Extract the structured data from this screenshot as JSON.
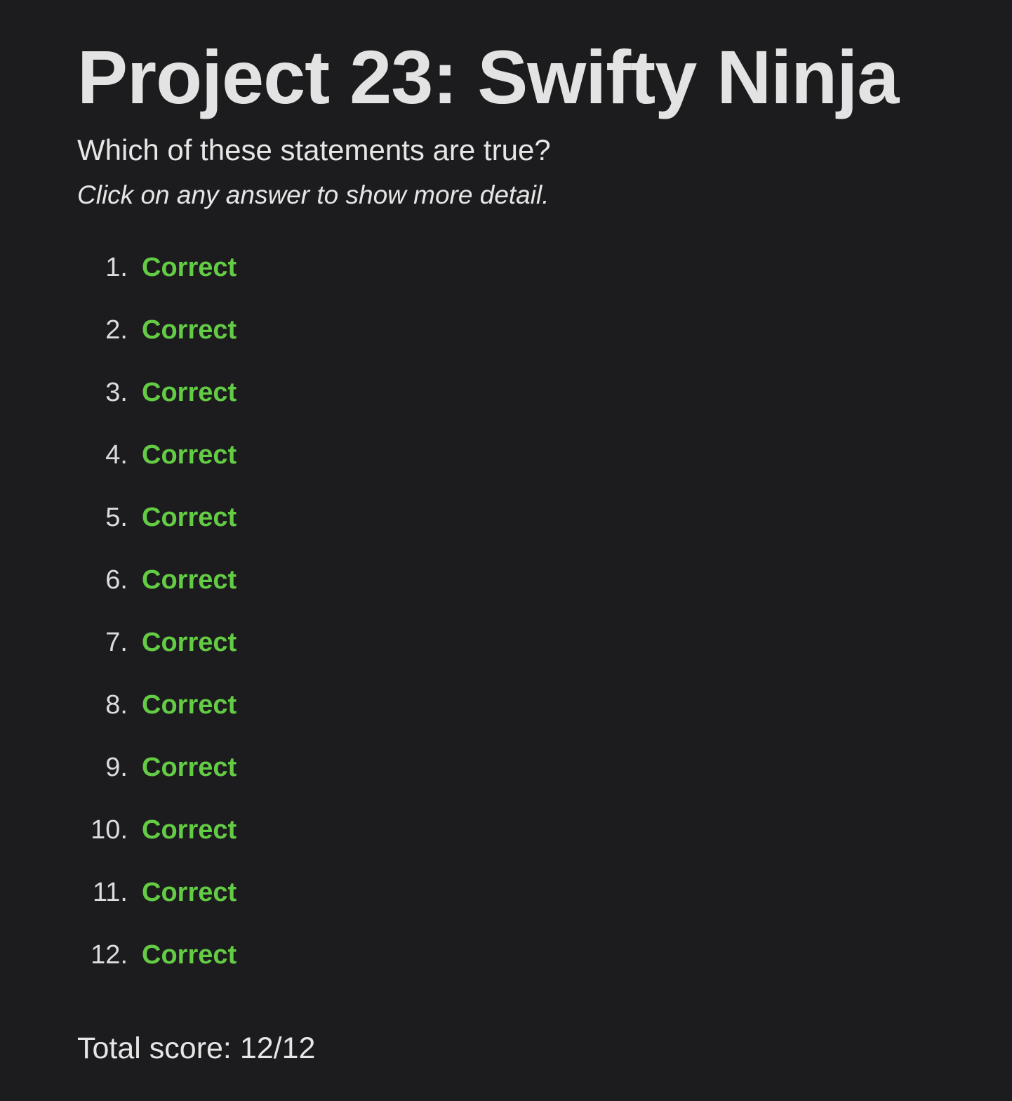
{
  "header": {
    "title": "Project 23: Swifty Ninja",
    "subtitle": "Which of these statements are true?",
    "hint": "Click on any answer to show more detail."
  },
  "answers": [
    {
      "number": "1.",
      "status": "Correct"
    },
    {
      "number": "2.",
      "status": "Correct"
    },
    {
      "number": "3.",
      "status": "Correct"
    },
    {
      "number": "4.",
      "status": "Correct"
    },
    {
      "number": "5.",
      "status": "Correct"
    },
    {
      "number": "6.",
      "status": "Correct"
    },
    {
      "number": "7.",
      "status": "Correct"
    },
    {
      "number": "8.",
      "status": "Correct"
    },
    {
      "number": "9.",
      "status": "Correct"
    },
    {
      "number": "10.",
      "status": "Correct"
    },
    {
      "number": "11.",
      "status": "Correct"
    },
    {
      "number": "12.",
      "status": "Correct"
    }
  ],
  "footer": {
    "score": "Total score: 12/12"
  },
  "colors": {
    "background": "#1c1c1e",
    "text": "#e6e6e6",
    "correct": "#63cc44"
  }
}
